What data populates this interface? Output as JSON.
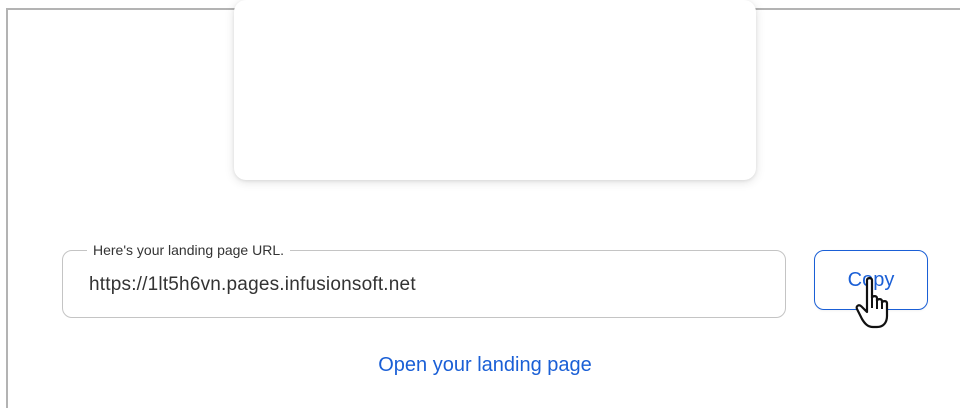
{
  "url_field": {
    "legend": "Here's your landing page URL.",
    "value": "https://1lt5h6vn.pages.infusionsoft.net"
  },
  "copy_button": {
    "label": "Copy"
  },
  "open_link": {
    "label": "Open your landing page"
  },
  "cursor": {
    "icon": "hand-pointer-icon"
  },
  "colors": {
    "accent": "#1a5fd6",
    "border": "#c4c4c4",
    "text": "#333333"
  }
}
